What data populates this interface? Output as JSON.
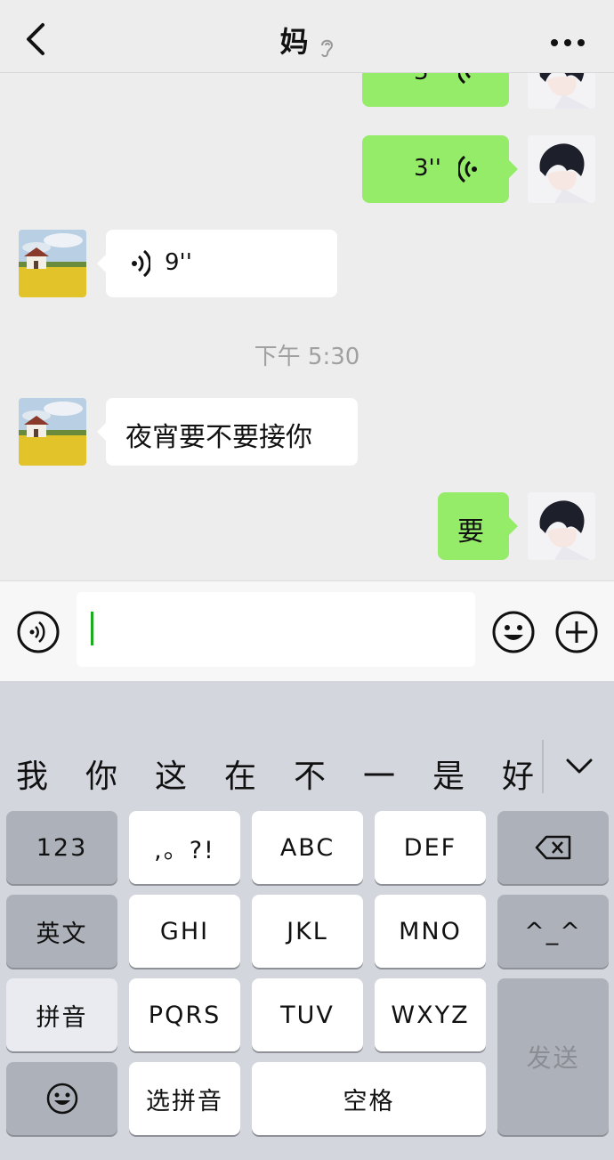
{
  "header": {
    "title": "妈"
  },
  "messages": {
    "voice_out_1_duration": "3''",
    "voice_out_2_duration": "3''",
    "voice_in_duration": "9''",
    "timestamp": "下午 5:30",
    "text_in": "夜宵要不要接你",
    "text_out": "要"
  },
  "input": {
    "value": ""
  },
  "keyboard": {
    "candidates": [
      "我",
      "你",
      "这",
      "在",
      "不",
      "一",
      "是",
      "好"
    ],
    "keys": {
      "num": "123",
      "punct": ",。?!",
      "abc": "ABC",
      "def": "DEF",
      "english": "英文",
      "ghi": "GHI",
      "jkl": "JKL",
      "mno": "MNO",
      "emoticon": "^_^",
      "pinyin": "拼音",
      "pqrs": "PQRS",
      "tuv": "TUV",
      "wxyz": "WXYZ",
      "send": "发送",
      "select_pinyin": "选拼音",
      "space": "空格"
    }
  },
  "colors": {
    "outgoing_bubble": "#95ec69",
    "incoming_bubble": "#ffffff",
    "background": "#ededed",
    "caret": "#1aad19"
  },
  "icons": [
    "back-arrow-icon",
    "ear-icon",
    "more-icon",
    "voice-icon",
    "emoji-icon",
    "plus-icon",
    "backspace-icon"
  ]
}
